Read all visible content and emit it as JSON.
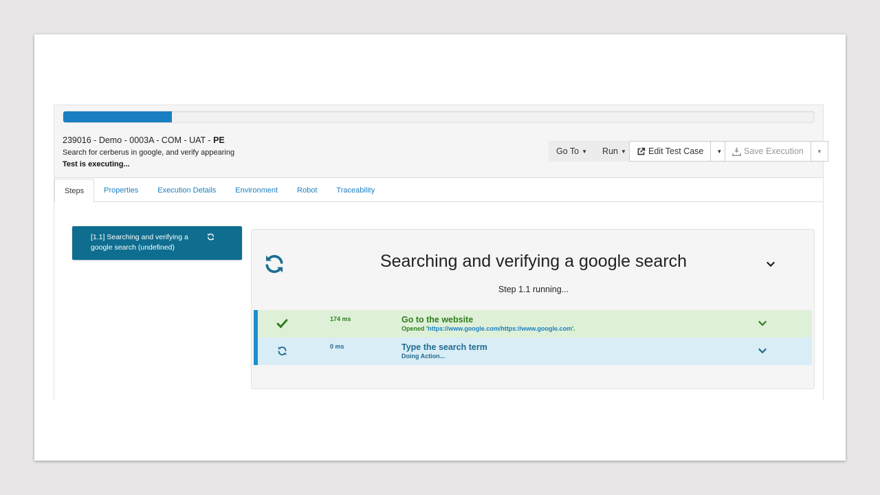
{
  "colors": {
    "primary": "#1a7fc2",
    "step_active_bg": "#0f6e8f",
    "success_bg": "#dff0d8",
    "success_text": "#2f7d1f",
    "info_bg": "#d9edf7",
    "info_text": "#1f6b8e"
  },
  "progress": {
    "fraction": 0.145
  },
  "execution": {
    "title_prefix": "239016 - Demo - 0003A - COM - UAT - ",
    "title_country": "PE",
    "description": "Search for cerberus in google, and verify appearing",
    "status": "Test is executing..."
  },
  "toolbar": {
    "goto_label": "Go To",
    "run_label": "Run",
    "edit_label": "Edit Test Case",
    "save_label": "Save Execution",
    "caret": "▼"
  },
  "tabs": [
    {
      "label": "Steps",
      "active": true
    },
    {
      "label": "Properties"
    },
    {
      "label": "Execution Details"
    },
    {
      "label": "Environment"
    },
    {
      "label": "Robot"
    },
    {
      "label": "Traceability"
    }
  ],
  "step_list": [
    {
      "label": "[1.1] Searching and verifying a google search (undefined)",
      "icon": "refresh-icon"
    }
  ],
  "step_detail": {
    "title": "Searching and verifying a google search",
    "status": "Step 1.1 running...",
    "icon": "refresh-icon"
  },
  "actions": [
    {
      "duration": "174 ms",
      "title": "Go to the website",
      "sub_prefix": "Opened '",
      "sub_link": "https://www.google.com/https://www.google.com",
      "sub_suffix": "'.",
      "icon": "check-icon"
    },
    {
      "duration": "0 ms",
      "title": "Type the search term",
      "sub": "Doing Action...",
      "icon": "refresh-icon"
    }
  ]
}
